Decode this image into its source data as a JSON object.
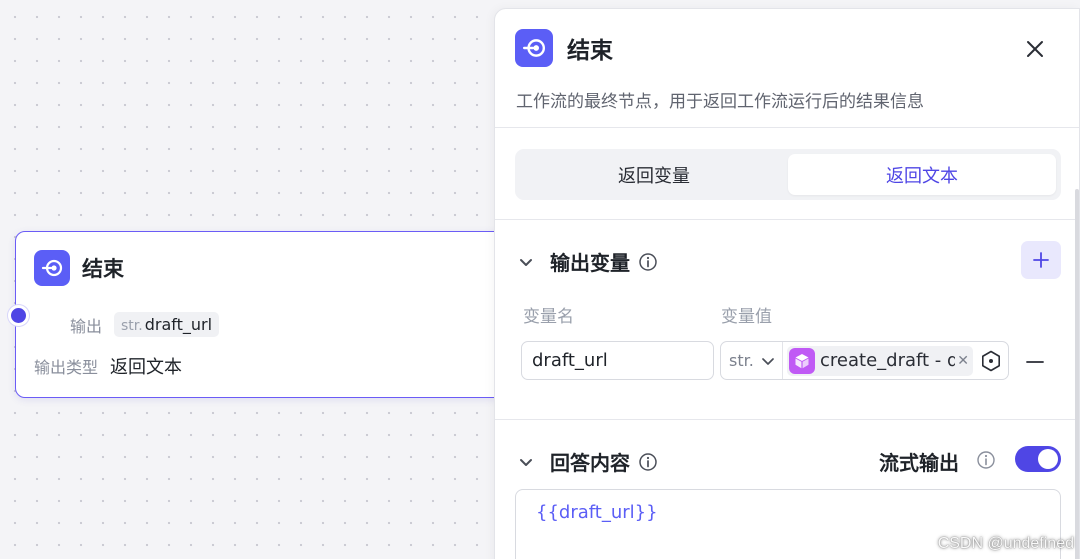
{
  "node": {
    "title": "结束",
    "icon": "end-node-icon",
    "output_label": "输出",
    "output_tag_type": "str.",
    "output_tag_name": "draft_url",
    "output_type_label": "输出类型",
    "output_type_value": "返回文本"
  },
  "panel": {
    "title": "结束",
    "icon": "end-node-icon",
    "description": "工作流的最终节点，用于返回工作流运行后的结果信息",
    "tabs": [
      {
        "label": "返回变量",
        "active": false
      },
      {
        "label": "返回文本",
        "active": true
      }
    ],
    "output_section": {
      "title": "输出变量",
      "col_name": "变量名",
      "col_value": "变量值",
      "rows": [
        {
          "name": "draft_url",
          "type": "str.",
          "ref_text": "create_draft - draft_url"
        }
      ]
    },
    "answer_section": {
      "title": "回答内容",
      "stream_label": "流式输出",
      "stream_enabled": true,
      "content": "{{draft_url}}"
    }
  },
  "watermark": "CSDN @undefined",
  "colors": {
    "accent": "#4f46e5",
    "node_icon_bg": "#5b5ef6",
    "ref_icon_bg": "#c05af5"
  }
}
